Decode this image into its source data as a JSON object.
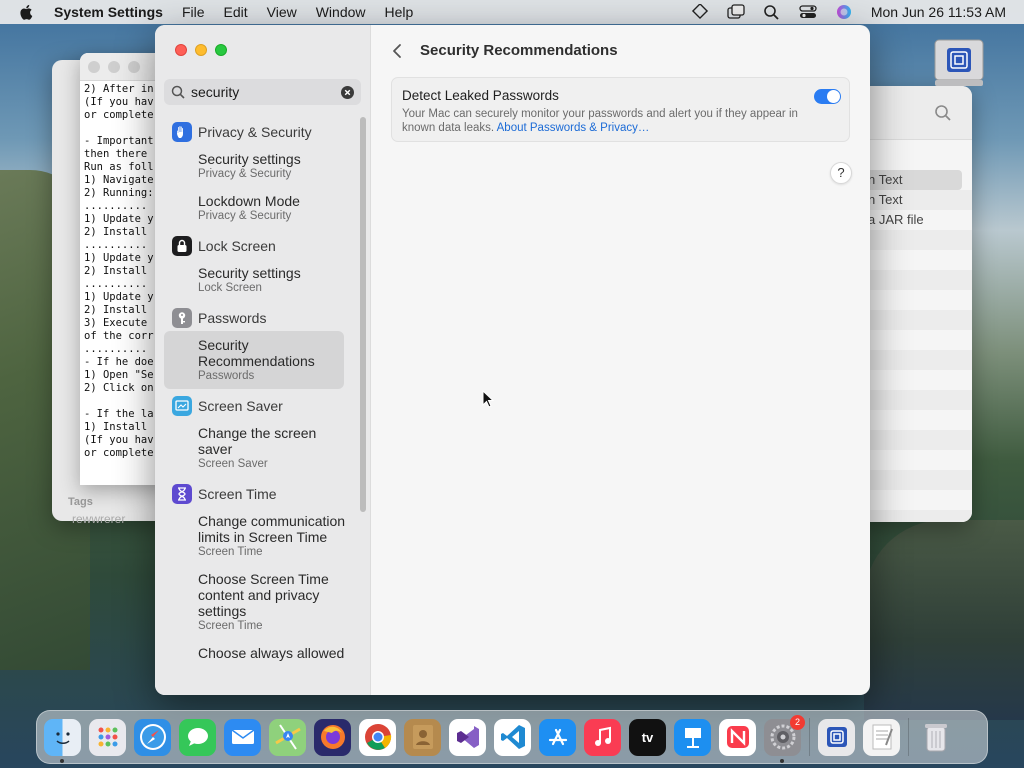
{
  "menubar": {
    "app_name": "System Settings",
    "menus": [
      "File",
      "Edit",
      "View",
      "Window",
      "Help"
    ],
    "clock": "Mon Jun 26  11:53 AM"
  },
  "background_text": "2) After in\n(If you hav\nor complete\n\n- Important\nthen there\nRun as foll\n1) Navigate\n2) Running:\n..........\n1) Update y\n2) Install\n..........\n1) Update y\n2) Install\n..........\n1) Update y\n2) Install\n3) Execute\nof the corr\n..........\n- If he doe\n1) Open \"Se\n2) Click on\n\n- If the la\n1) Install\n(If you hav\nor complete",
  "finder_bg": {
    "tags_label": "Tags",
    "tag_value": "rewwrerer"
  },
  "right_bg_rows": [
    "n Text",
    "n Text",
    "a JAR file"
  ],
  "search": {
    "value": "security"
  },
  "results": [
    {
      "group": "Privacy & Security",
      "icon": "hand-icon",
      "color": "#2f6fe0",
      "items": [
        {
          "title": "Security settings",
          "sub": "Privacy & Security"
        },
        {
          "title": "Lockdown Mode",
          "sub": "Privacy & Security"
        }
      ]
    },
    {
      "group": "Lock Screen",
      "icon": "lock-icon",
      "color": "#1d1d1f",
      "items": [
        {
          "title": "Security settings",
          "sub": "Lock Screen"
        }
      ]
    },
    {
      "group": "Passwords",
      "icon": "key-icon",
      "color": "#8e8e93",
      "items": [
        {
          "title": "Security Recommendations",
          "sub": "Passwords",
          "selected": true
        }
      ]
    },
    {
      "group": "Screen Saver",
      "icon": "screen-saver-icon",
      "color": "#3aa7e0",
      "items": [
        {
          "title": "Change the screen saver",
          "sub": "Screen Saver"
        }
      ]
    },
    {
      "group": "Screen Time",
      "icon": "hourglass-icon",
      "color": "#5e4ad0",
      "items": [
        {
          "title": "Change communication limits in Screen Time",
          "sub": "Screen Time"
        },
        {
          "title": "Choose Screen Time content and privacy settings",
          "sub": "Screen Time"
        },
        {
          "title": "Choose always allowed",
          "sub": ""
        }
      ]
    }
  ],
  "content": {
    "title": "Security Recommendations",
    "card_title": "Detect Leaked Passwords",
    "card_desc": "Your Mac can securely monitor your passwords and alert you if they appear in known data leaks.",
    "card_link": "About Passwords & Privacy…",
    "toggle_on": true,
    "help": "?"
  },
  "dock": {
    "apps": [
      "Finder",
      "Launchpad",
      "Safari",
      "Messages",
      "Mail",
      "Maps",
      "Firefox",
      "Chrome",
      "Contacts",
      "Visual Studio",
      "VS Code",
      "App Store",
      "Music",
      "TV",
      "Keynote",
      "News",
      "System Settings"
    ],
    "settings_badge": "2",
    "tv_label": "tv"
  }
}
